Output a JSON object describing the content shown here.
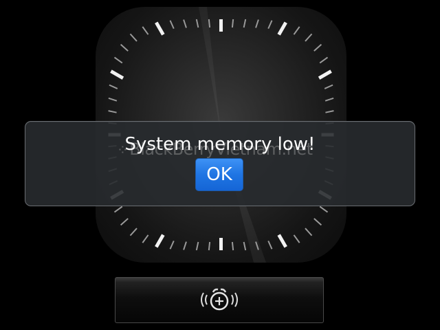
{
  "dialog": {
    "message": "System memory low!",
    "ok_label": "OK"
  },
  "watermark": {
    "text": "BlackBerryVietnam.net"
  },
  "alarm": {
    "icon": "alarm-add-icon"
  },
  "colors": {
    "background": "#000000",
    "dialog_fill": "#282b2f",
    "dialog_border": "#6a6e73",
    "button_blue": "#1f75e3",
    "text": "#ffffff"
  }
}
